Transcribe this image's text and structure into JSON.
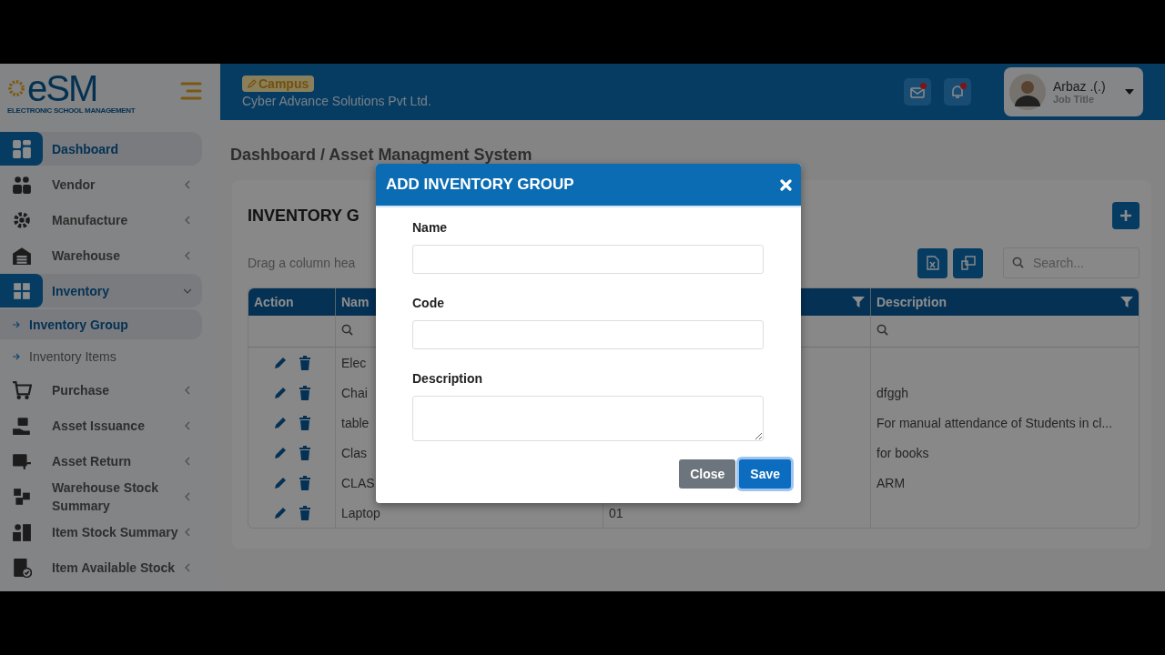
{
  "logo": {
    "mark": "eSM",
    "tagline": "ELECTRONIC SCHOOL MANAGEMENT"
  },
  "sidebar": {
    "items": [
      {
        "label": "Dashboard",
        "selected": true
      },
      {
        "label": "Vendor",
        "selected": false,
        "expanded": false
      },
      {
        "label": "Manufacture",
        "selected": false,
        "expanded": false
      },
      {
        "label": "Warehouse",
        "selected": false,
        "expanded": false
      },
      {
        "label": "Inventory",
        "selected": true,
        "expanded": true,
        "children": [
          {
            "label": "Inventory Group",
            "selected": true
          },
          {
            "label": "Inventory Items",
            "selected": false
          }
        ]
      },
      {
        "label": "Purchase",
        "selected": false,
        "expanded": false
      },
      {
        "label": "Asset Issuance",
        "selected": false,
        "expanded": false
      },
      {
        "label": "Asset Return",
        "selected": false,
        "expanded": false
      },
      {
        "label": "Warehouse Stock Summary",
        "selected": false,
        "expanded": false
      },
      {
        "label": "Item Stock Summary",
        "selected": false,
        "expanded": false
      },
      {
        "label": "Item Available Stock",
        "selected": false,
        "expanded": false
      }
    ]
  },
  "header": {
    "badge": "Campus",
    "organization": "Cyber Advance Solutions Pvt Ltd.",
    "mail_unread": true,
    "bell_unread": true,
    "user": {
      "name": "Arbaz .(.)",
      "role": "Job Title"
    }
  },
  "breadcrumb": "Dashboard / Asset Managment System",
  "card": {
    "title": "INVENTORY G",
    "hint": "Drag a column hea",
    "search": {
      "placeholder": "Search..."
    },
    "table": {
      "columns": [
        {
          "label": "Action",
          "filter": false,
          "search": false
        },
        {
          "label": "Nam",
          "filter": false,
          "search": true
        },
        {
          "filter": true,
          "search": false
        },
        {
          "label": "Description",
          "filter": true,
          "search": true
        }
      ],
      "rows": [
        {
          "name": "Elec"
        },
        {
          "name": "Chai",
          "description": "dfggh"
        },
        {
          "name": "table",
          "description": "For manual attendance of Students in cl..."
        },
        {
          "name": "Clas",
          "description": "for books"
        },
        {
          "name": "CLAS",
          "description": "ARM"
        },
        {
          "name": "Laptop",
          "code": "01"
        }
      ]
    }
  },
  "modal": {
    "title": "ADD INVENTORY GROUP",
    "fields": [
      {
        "label": "Name",
        "kind": "input"
      },
      {
        "label": "Code",
        "kind": "input"
      },
      {
        "label": "Description",
        "kind": "textarea"
      }
    ],
    "buttons": [
      {
        "label": "Close",
        "kind": "secondary"
      },
      {
        "label": "Save",
        "kind": "primary"
      }
    ]
  }
}
